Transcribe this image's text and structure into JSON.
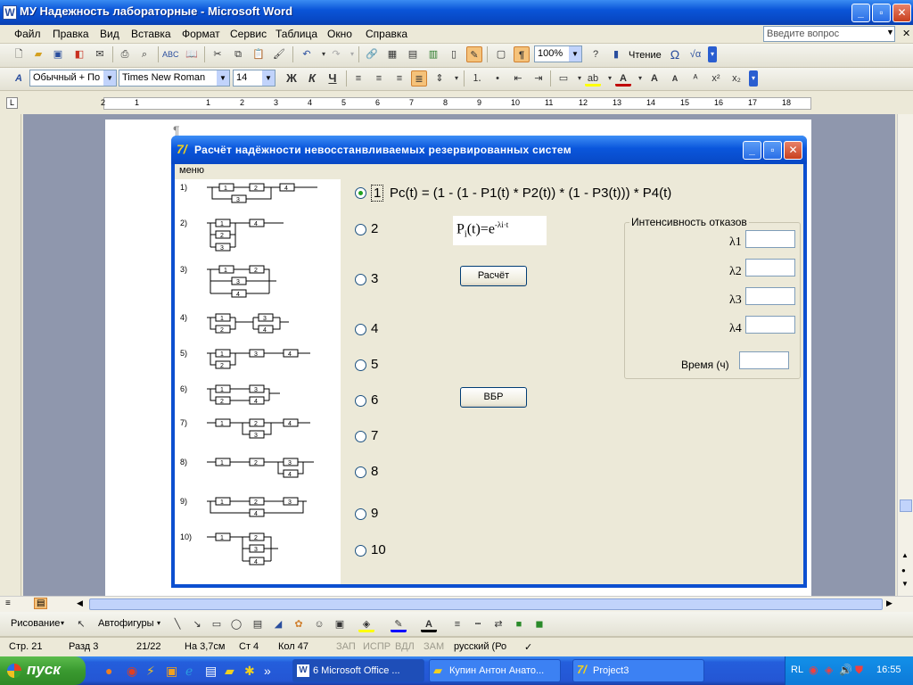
{
  "window": {
    "title": "МУ Надежность лабораторные - Microsoft Word"
  },
  "menu": {
    "items": [
      "Файл",
      "Правка",
      "Вид",
      "Вставка",
      "Формат",
      "Сервис",
      "Таблица",
      "Окно",
      "Справка"
    ],
    "ask_placeholder": "Введите вопрос"
  },
  "toolbar1": {
    "zoom": "100%",
    "reading": "Чтение"
  },
  "toolbar2": {
    "style": "Обычный + По ц",
    "font": "Times New Roman",
    "size": "14"
  },
  "ruler": {
    "ticks": [
      "2",
      "1",
      "1",
      "2",
      "3",
      "4",
      "5",
      "6",
      "7",
      "8",
      "9",
      "10",
      "11",
      "12",
      "13",
      "14",
      "15",
      "16",
      "17",
      "18"
    ]
  },
  "dialog": {
    "title": "Расчёт надёжности невосстанвливаемых резервированных систем",
    "menu": "меню",
    "scheme_numbers": [
      "1)",
      "2)",
      "3)",
      "4)",
      "5)",
      "6)",
      "7)",
      "8)",
      "9)",
      "10)"
    ],
    "options": [
      "1",
      "2",
      "3",
      "4",
      "5",
      "6",
      "7",
      "8",
      "9",
      "10"
    ],
    "selected_option": "1",
    "formula": "Pc(t) = (1 - (1 - P1(t) * P2(t)) * (1 - P3(t))) * P4(t)",
    "law": {
      "left": "P",
      "sub": "i",
      "arg": "(t)=e",
      "exp": "-λi·t"
    },
    "calc_button": "Расчёт",
    "vbr_button": "ВБР",
    "group_title": "Интенсивность отказов",
    "lambda_labels": [
      "λ1",
      "λ2",
      "λ3",
      "λ4"
    ],
    "time_label": "Время (ч)"
  },
  "draw_toolbar": {
    "draw": "Рисование",
    "autoshapes": "Автофигуры"
  },
  "status": {
    "page": "Стр. 21",
    "section": "Разд 3",
    "pages": "21/22",
    "at": "На 3,7см",
    "line": "Ст 4",
    "col": "Кол 47",
    "rec": "ЗАП",
    "trk": "ИСПР",
    "ext": "ВДЛ",
    "ovr": "ЗАМ",
    "lang": "русский (Ро"
  },
  "taskbar": {
    "start": "пуск",
    "tasks": [
      "6 Microsoft Office ...",
      "Купин Антон Анато...",
      "Project3"
    ],
    "lang": "RL",
    "clock": "16:55"
  }
}
